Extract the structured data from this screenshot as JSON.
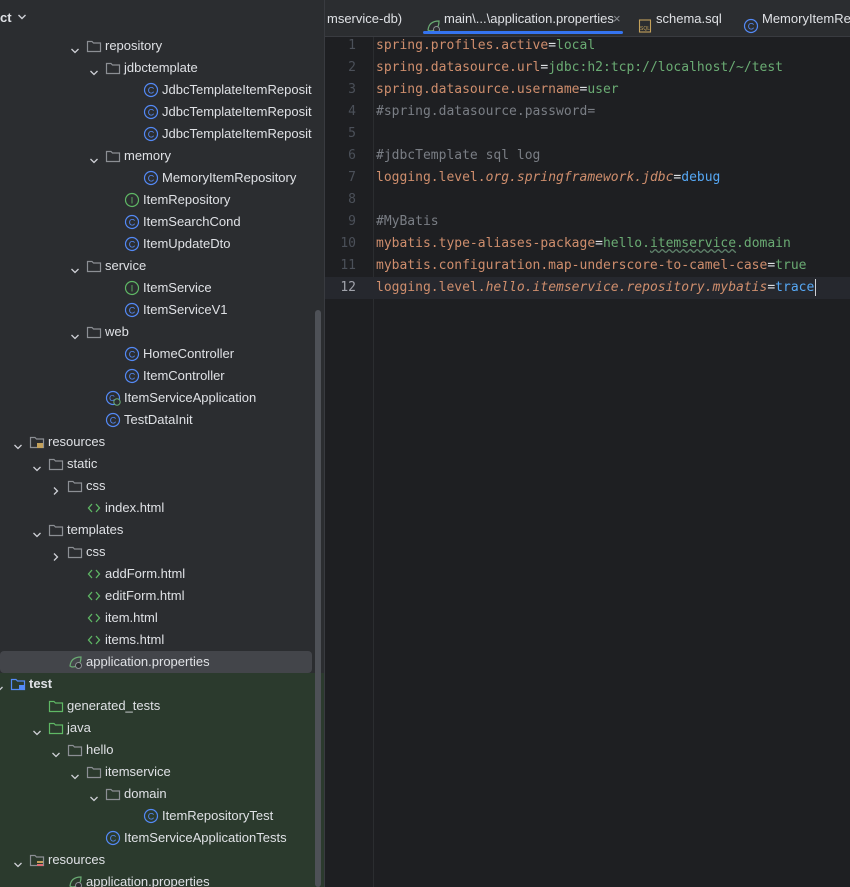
{
  "sidebar": {
    "title": "ct",
    "tree": [
      {
        "label": "repository",
        "icon": "folder-icon",
        "expanded": true
      },
      {
        "label": "jdbctemplate",
        "icon": "folder-icon",
        "expanded": true
      },
      {
        "label": "JdbcTemplateItemReposit",
        "icon": "class-icon"
      },
      {
        "label": "JdbcTemplateItemReposit",
        "icon": "class-icon"
      },
      {
        "label": "JdbcTemplateItemReposit",
        "icon": "class-icon"
      },
      {
        "label": "memory",
        "icon": "folder-icon",
        "expanded": true
      },
      {
        "label": "MemoryItemRepository",
        "icon": "class-icon"
      },
      {
        "label": "ItemRepository",
        "icon": "interface-icon"
      },
      {
        "label": "ItemSearchCond",
        "icon": "class-icon"
      },
      {
        "label": "ItemUpdateDto",
        "icon": "class-icon"
      },
      {
        "label": "service",
        "icon": "folder-icon",
        "expanded": true
      },
      {
        "label": "ItemService",
        "icon": "interface-icon"
      },
      {
        "label": "ItemServiceV1",
        "icon": "class-icon"
      },
      {
        "label": "web",
        "icon": "folder-icon",
        "expanded": true
      },
      {
        "label": "HomeController",
        "icon": "class-icon"
      },
      {
        "label": "ItemController",
        "icon": "class-icon"
      },
      {
        "label": "ItemServiceApplication",
        "icon": "spring-app-icon"
      },
      {
        "label": "TestDataInit",
        "icon": "class-icon"
      },
      {
        "label": "resources",
        "icon": "resources-folder-icon",
        "expanded": true
      },
      {
        "label": "static",
        "icon": "folder-icon",
        "expanded": true
      },
      {
        "label": "css",
        "icon": "folder-icon",
        "expanded": false
      },
      {
        "label": "index.html",
        "icon": "html-icon"
      },
      {
        "label": "templates",
        "icon": "folder-icon",
        "expanded": true
      },
      {
        "label": "css",
        "icon": "folder-icon",
        "expanded": false
      },
      {
        "label": "addForm.html",
        "icon": "html-icon"
      },
      {
        "label": "editForm.html",
        "icon": "html-icon"
      },
      {
        "label": "item.html",
        "icon": "html-icon"
      },
      {
        "label": "items.html",
        "icon": "html-icon"
      },
      {
        "label": "application.properties",
        "icon": "spring-properties-icon",
        "selected": true
      },
      {
        "label": "test",
        "icon": "test-module-icon",
        "expanded": true
      },
      {
        "label": "generated_tests",
        "icon": "test-folder-icon"
      },
      {
        "label": "java",
        "icon": "test-folder-icon",
        "expanded": true
      },
      {
        "label": "hello",
        "icon": "folder-icon",
        "expanded": true
      },
      {
        "label": "itemservice",
        "icon": "folder-icon",
        "expanded": true
      },
      {
        "label": "domain",
        "icon": "folder-icon",
        "expanded": true
      },
      {
        "label": "ItemRepositoryTest",
        "icon": "class-icon"
      },
      {
        "label": "ItemServiceApplicationTests",
        "icon": "class-icon"
      },
      {
        "label": "resources",
        "icon": "test-resources-folder-icon",
        "expanded": true
      },
      {
        "label": "application.properties",
        "icon": "spring-properties-icon"
      }
    ]
  },
  "tabs": [
    {
      "label": "mservice-db)",
      "icon": "",
      "active": false
    },
    {
      "label": "main\\...\\application.properties",
      "icon": "spring-properties-icon",
      "active": true,
      "close": "×"
    },
    {
      "label": "schema.sql",
      "icon": "sql-icon",
      "active": false
    },
    {
      "label": "MemoryItemRep",
      "icon": "class-icon",
      "active": false
    }
  ],
  "editor": {
    "current_line": 12,
    "lines": [
      {
        "n": "1",
        "tokens": [
          [
            "spring.profiles.active",
            "k"
          ],
          [
            "=",
            "eq"
          ],
          [
            "local",
            "v"
          ]
        ]
      },
      {
        "n": "2",
        "tokens": [
          [
            "spring.datasource.url",
            "k"
          ],
          [
            "=",
            "eq"
          ],
          [
            "jdbc:h2:tcp://localhost/~/test",
            "v"
          ]
        ]
      },
      {
        "n": "3",
        "tokens": [
          [
            "spring.datasource.username",
            "k"
          ],
          [
            "=",
            "eq"
          ],
          [
            "user",
            "v"
          ]
        ]
      },
      {
        "n": "4",
        "tokens": [
          [
            "#spring.datasource.password=",
            "cm"
          ]
        ]
      },
      {
        "n": "5",
        "tokens": []
      },
      {
        "n": "6",
        "tokens": [
          [
            "#jdbcTemplate sql log",
            "cm"
          ]
        ]
      },
      {
        "n": "7",
        "tokens": [
          [
            "logging.level.",
            "k"
          ],
          [
            "org.springframework.jdbc",
            "vi"
          ],
          [
            "=",
            "eq"
          ],
          [
            "debug",
            "vb"
          ]
        ]
      },
      {
        "n": "8",
        "tokens": []
      },
      {
        "n": "9",
        "tokens": [
          [
            "#MyBatis",
            "cm"
          ]
        ]
      },
      {
        "n": "10",
        "tokens": [
          [
            "mybatis.type-aliases-package",
            "k"
          ],
          [
            "=",
            "eq"
          ],
          [
            "hello.",
            "v"
          ],
          [
            "itemservice",
            "v squig"
          ],
          [
            ".domain",
            "v"
          ]
        ]
      },
      {
        "n": "11",
        "tokens": [
          [
            "mybatis.configuration.map-underscore-to-camel-case",
            "k"
          ],
          [
            "=",
            "eq"
          ],
          [
            "true",
            "v"
          ]
        ]
      },
      {
        "n": "12",
        "tokens": [
          [
            "logging.level.",
            "k"
          ],
          [
            "hello.itemservice.repository.mybatis",
            "vi"
          ],
          [
            "=",
            "eq"
          ],
          [
            "trace",
            "vb"
          ]
        ]
      }
    ]
  },
  "colors": {
    "accent": "#3574f0",
    "folder": "#8c8f94",
    "class": "#548af7",
    "interface": "#5fb865",
    "html": "#5fb865",
    "spring": "#6aab73"
  }
}
